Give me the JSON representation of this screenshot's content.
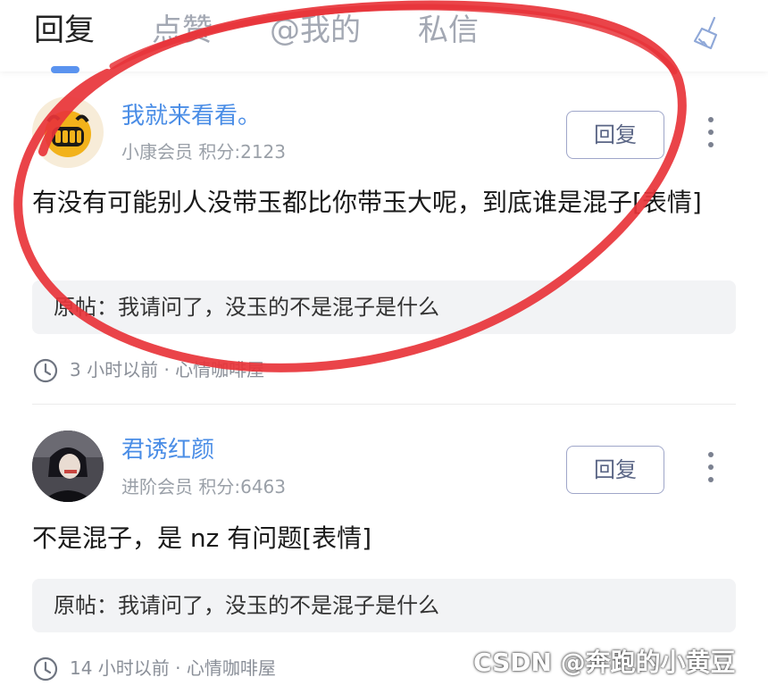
{
  "tabs": [
    {
      "label": "回复",
      "active": true
    },
    {
      "label": "点赞",
      "active": false
    },
    {
      "label": "@我的",
      "active": false
    },
    {
      "label": "私信",
      "active": false
    }
  ],
  "clear_icon": "broom-icon",
  "comments": [
    {
      "username": "我就来看看。",
      "level": "小康会员",
      "points": "积分:2123",
      "reply_label": "回复",
      "content": "有没有可能别人没带玉都比你带玉大呢，到底谁是混子[表情]",
      "quote": "原帖：我请问了，没玉的不是混子是什么",
      "time_info": "3 小时以前 · 心情咖啡屋",
      "avatar_icon": "grin-face-avatar"
    },
    {
      "username": "君诱红颜",
      "level": "进阶会员",
      "points": "积分:6463",
      "reply_label": "回复",
      "content": "不是混子，是 nz 有问题[表情]",
      "quote": "原帖：我请问了，没玉的不是混子是什么",
      "time_info": "14 小时以前 · 心情咖啡屋",
      "avatar_icon": "anime-portrait-avatar"
    }
  ],
  "watermark": "CSDN @奔跑的小黄豆",
  "colors": {
    "accent": "#4a8de6",
    "annotation": "#e8343a"
  }
}
